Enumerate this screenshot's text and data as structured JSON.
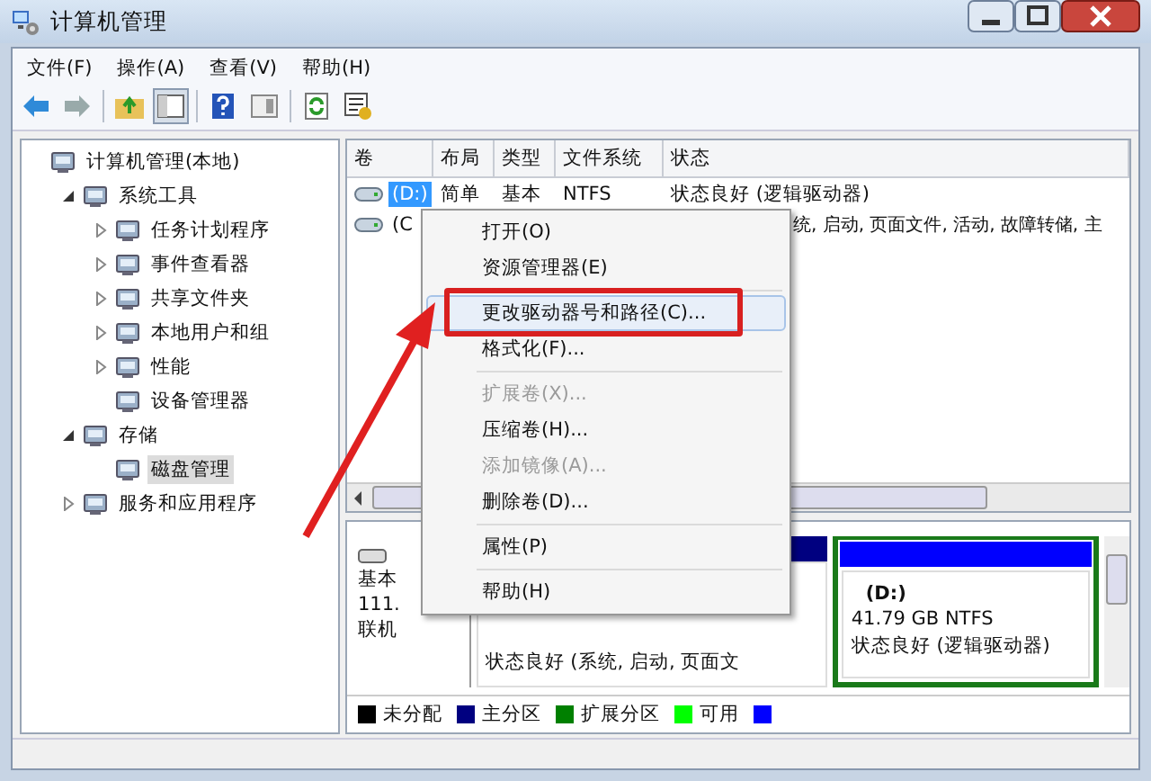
{
  "window": {
    "title": "计算机管理"
  },
  "menu_bar": [
    "文件(F)",
    "操作(A)",
    "查看(V)",
    "帮助(H)"
  ],
  "tree": [
    {
      "label": "计算机管理(本地)",
      "selected": false,
      "children": [
        {
          "label": "系统工具",
          "expanded": true,
          "selected": false,
          "children": [
            {
              "label": "任务计划程序",
              "expanded": false,
              "selected": false
            },
            {
              "label": "事件查看器",
              "expanded": false,
              "selected": false
            },
            {
              "label": "共享文件夹",
              "expanded": false,
              "selected": false
            },
            {
              "label": "本地用户和组",
              "expanded": false,
              "selected": false
            },
            {
              "label": "性能",
              "expanded": false,
              "selected": false
            },
            {
              "label": "设备管理器",
              "selected": false
            }
          ]
        },
        {
          "label": "存储",
          "expanded": true,
          "selected": false,
          "children": [
            {
              "label": "磁盘管理",
              "selected": true
            }
          ]
        },
        {
          "label": "服务和应用程序",
          "expanded": false,
          "selected": false
        }
      ]
    }
  ],
  "volume_table": {
    "columns": [
      "卷",
      "布局",
      "类型",
      "文件系统",
      "状态"
    ],
    "rows": [
      {
        "volume": "(D:)",
        "layout": "简单",
        "type": "基本",
        "file_system": "NTFS",
        "status": "状态良好 (逻辑驱动器)",
        "selected": true
      },
      {
        "volume": "(C",
        "status": "统, 启动, 页面文件, 活动, 故障转储, 主",
        "selected": false
      }
    ]
  },
  "disk": {
    "type": "基本",
    "size": "111.",
    "state": "联机",
    "partitions": [
      {
        "kind": "primary",
        "color": "#000080",
        "lines": [
          "状态良好 (系统, 启动, 页面文"
        ]
      },
      {
        "kind": "logical",
        "color": "#0000ff",
        "name": "(D:)",
        "lines": [
          "41.79 GB NTFS",
          "状态良好 (逻辑驱动器)"
        ]
      }
    ]
  },
  "legend": [
    {
      "label": "未分配",
      "color": "#000000"
    },
    {
      "label": "主分区",
      "color": "#000080"
    },
    {
      "label": "扩展分区",
      "color": "#008000"
    },
    {
      "label": "可用",
      "color": "#00ff00"
    },
    {
      "color": "#0000ff"
    }
  ],
  "context_menu": [
    {
      "kind": "item",
      "label": "打开(O)",
      "disabled": false,
      "selected": false
    },
    {
      "kind": "item",
      "label": "资源管理器(E)",
      "disabled": false,
      "selected": false
    },
    {
      "kind": "separator"
    },
    {
      "kind": "item",
      "label": "更改驱动器号和路径(C)...",
      "disabled": false,
      "selected": true,
      "annotated": true
    },
    {
      "kind": "item",
      "label": "格式化(F)...",
      "disabled": false,
      "selected": false
    },
    {
      "kind": "separator"
    },
    {
      "kind": "item",
      "label": "扩展卷(X)...",
      "disabled": true,
      "selected": false
    },
    {
      "kind": "item",
      "label": "压缩卷(H)...",
      "disabled": false,
      "selected": false
    },
    {
      "kind": "item",
      "label": "添加镜像(A)...",
      "disabled": true,
      "selected": false
    },
    {
      "kind": "item",
      "label": "删除卷(D)...",
      "disabled": false,
      "selected": false
    },
    {
      "kind": "separator"
    },
    {
      "kind": "item",
      "label": "属性(P)",
      "disabled": false,
      "selected": false
    },
    {
      "kind": "separator"
    },
    {
      "kind": "item",
      "label": "帮助(H)",
      "disabled": false,
      "selected": false
    }
  ]
}
